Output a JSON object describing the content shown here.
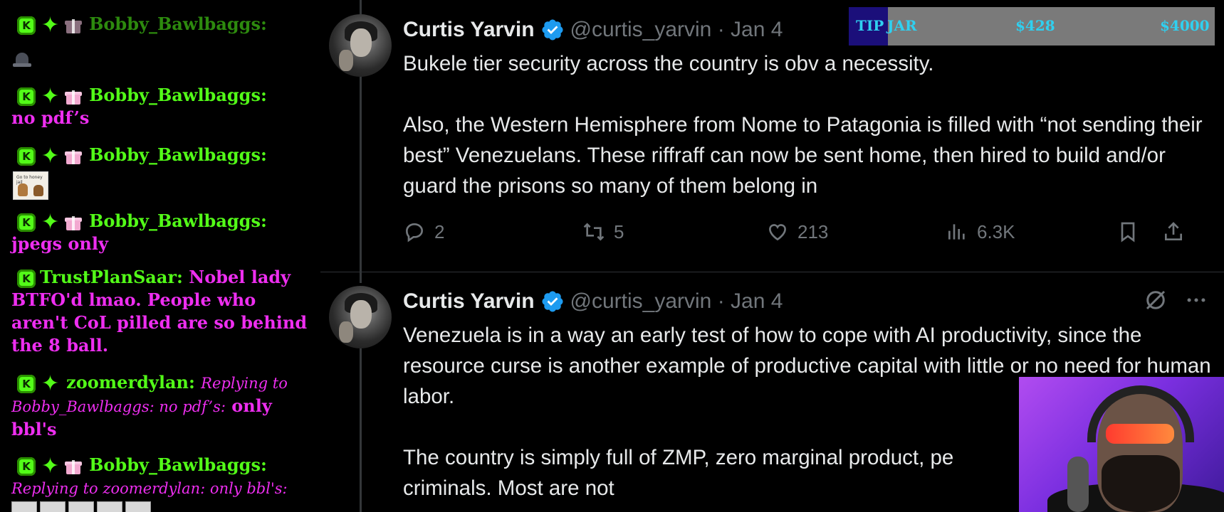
{
  "chat": {
    "messages": [
      {
        "user": "Bobby_Bawlbaggs:",
        "text": "",
        "dim": true
      },
      {
        "user": "Bobby_Bawlbaggs:",
        "text": "no pdf’s"
      },
      {
        "user": "Bobby_Bawlbaggs:",
        "text": ""
      },
      {
        "user": "Bobby_Bawlbaggs:",
        "text": "jpegs only"
      },
      {
        "user": "TrustPlanSaar:",
        "text": "Nobel lady BTFO'd lmao. People who aren't CoL pilled are so behind the 8 ball."
      },
      {
        "user": "zoomerdylan:",
        "reply": "Replying to Bobby_Bawlbaggs: no pdf’s:",
        "text": "only bbl's"
      },
      {
        "user": "Bobby_Bawlbaggs:",
        "reply": "Replying to zoomerdylan: only bbl's:",
        "text": ""
      }
    ],
    "emote_caption": "Go to honey jail"
  },
  "tweets": [
    {
      "name": "Curtis Yarvin",
      "handle": "@curtis_yarvin · Jan 4",
      "text": "Bukele tier security across the country is obv a necessity.\n\nAlso, the Western Hemisphere from Nome to Patagonia is filled with “not sending their best” Venezuelans. These riffraff can now be sent home, then hired to build and/or guard the prisons so many of them belong in",
      "replies": "2",
      "retweets": "5",
      "likes": "213",
      "views": "6.3K"
    },
    {
      "name": "Curtis Yarvin",
      "handle": "@curtis_yarvin · Jan 4",
      "text": "Venezuela is in a way an early test of how to cope with AI productivity, since the resource curse is another example of productive capital with little or no need for human labor.\n\nThe country is simply full of ZMP, zero marginal product, pe\ncriminals. Most are not"
    }
  ],
  "tipjar": {
    "label1": "TIP",
    "label2": "JAR",
    "current": "$428",
    "goal": "$4000",
    "progress": 0.107
  },
  "colors": {
    "brand_green": "#53fc18",
    "chat_text": "#ee2ef0",
    "verified_blue": "#1d9bf0",
    "muted": "#71767b"
  },
  "icons": [
    "kick-badge-icon",
    "sparkle-badge-icon",
    "gift-badge-icon",
    "verified-badge-icon",
    "reply-icon",
    "retweet-icon",
    "like-icon",
    "views-icon",
    "bookmark-icon",
    "share-icon",
    "grok-icon",
    "more-icon"
  ]
}
